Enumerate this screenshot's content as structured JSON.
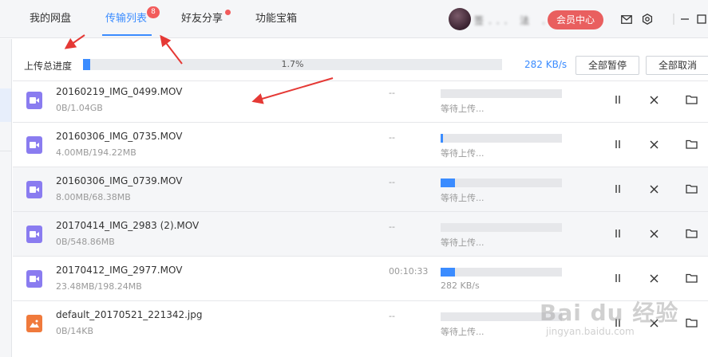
{
  "nav": {
    "tabs": [
      {
        "label": "我的网盘"
      },
      {
        "label": "传输列表",
        "badge": "8"
      },
      {
        "label": "好友分享"
      },
      {
        "label": "功能宝箱"
      }
    ],
    "username": "签... 法 ...",
    "vip_label": "会员中心"
  },
  "overall": {
    "label": "上传总进度",
    "percent_text": "1.7%",
    "progress": 1.7,
    "speed": "282 KB/s",
    "pause_all": "全部暂停",
    "cancel_all": "全部取消"
  },
  "files": [
    {
      "name": "20160219_IMG_0499.MOV",
      "size": "0B/1.04GB",
      "time": "--",
      "status": "等待上传...",
      "progress": 0,
      "type": "video"
    },
    {
      "name": "20160306_IMG_0735.MOV",
      "size": "4.00MB/194.22MB",
      "time": "--",
      "status": "等待上传...",
      "progress": 2,
      "type": "video"
    },
    {
      "name": "20160306_IMG_0739.MOV",
      "size": "8.00MB/68.38MB",
      "time": "--",
      "status": "等待上传...",
      "progress": 12,
      "type": "video"
    },
    {
      "name": "20170414_IMG_2983 (2).MOV",
      "size": "0B/548.86MB",
      "time": "--",
      "status": "等待上传...",
      "progress": 0,
      "type": "video"
    },
    {
      "name": "20170412_IMG_2977.MOV",
      "size": "23.48MB/198.24MB",
      "time": "00:10:33",
      "status": "282 KB/s",
      "progress": 12,
      "type": "video"
    },
    {
      "name": "default_20170521_221342.jpg",
      "size": "0B/14KB",
      "time": "--",
      "status": "等待上传...",
      "progress": 0,
      "type": "image"
    }
  ],
  "watermark": {
    "main": "Bai du 经验",
    "sub": "jingyan.baidu.com"
  },
  "colors": {
    "accent": "#3b8cff",
    "badge": "#f25b5b",
    "vip": "#e95f5f",
    "video_icon": "#8a7cf0",
    "image_icon": "#f07a3c",
    "arrow": "#e53935"
  }
}
